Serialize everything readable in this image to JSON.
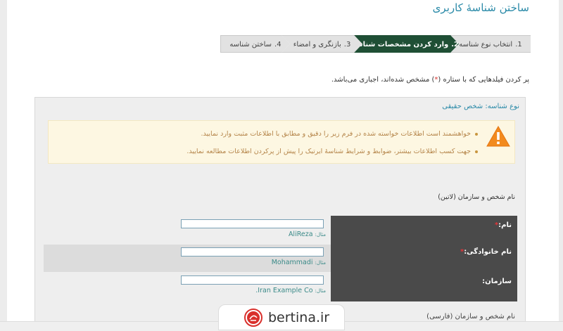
{
  "page": {
    "title": "ساختن شناسهٔ کاربری"
  },
  "steps": [
    {
      "num": "1.",
      "label": "انتخاب نوع شناسه",
      "active": false
    },
    {
      "num": "2.",
      "label": "وارد کردن مشخصات شناسه",
      "active": true
    },
    {
      "num": "3.",
      "label": "بازنگری و امضاء",
      "active": false
    },
    {
      "num": "4.",
      "label": "ساختن شناسه",
      "active": false
    }
  ],
  "instruction": {
    "before": "پر کردن فیلدهایی که با ستاره (",
    "star": "*",
    "after": ") مشخص شده‌اند، اجباری می‌باشد."
  },
  "panel": {
    "title": "نوع شناسه: شخص حقیقی",
    "warnings": [
      "خواهشمند است اطلاعات خواسته شده در فرم زیر را دقیق و مطابق با اطلاعات مثبت وارد نمایید.",
      "جهت کسب اطلاعات بیشتر، ضوابط و شرایط شناسهٔ ایرتیک را پیش از پرکردن اطلاعات مطالعه نمایید."
    ],
    "section_label": "نام شخص و سازمان (لاتین)",
    "fields": [
      {
        "label": "نام:",
        "required": true,
        "value": "",
        "example_label": "مثال:",
        "example": "AliReza"
      },
      {
        "label": "نام خانوادگی:",
        "required": true,
        "value": "",
        "example_label": "مثال:",
        "example": "Mohammadi"
      },
      {
        "label": "سازمان:",
        "required": false,
        "value": "",
        "example_label": "مثال:",
        "example": "Iran Example Co."
      }
    ],
    "bottom_label": "نام شخص و سازمان (فارسی)"
  },
  "watermark": {
    "text": "bertina.ir",
    "logo_icon": "bertina-logo-icon"
  },
  "colors": {
    "title": "#2a8aa8",
    "active_step": "#1f4f35",
    "warning_bg": "#fdf7e2",
    "warning_text": "#b5854a",
    "label_column": "#4a4a4a",
    "required_star": "#e0353a"
  }
}
